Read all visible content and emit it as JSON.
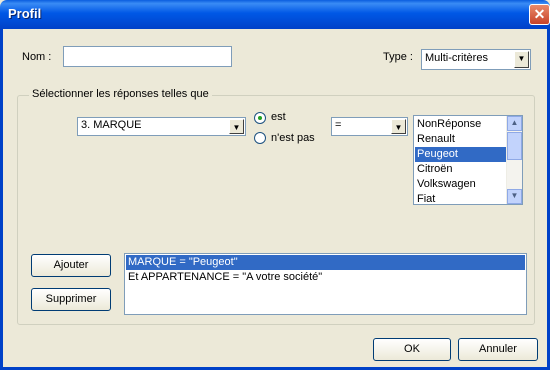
{
  "window": {
    "title": "Profil",
    "close_icon": "close-icon"
  },
  "form": {
    "nom_label": "Nom :",
    "nom_value": "",
    "type_label": "Type :",
    "type_value": "Multi-critères"
  },
  "group": {
    "title": "Sélectionner les réponses telles que",
    "question_value": "3. MARQUE",
    "radio_est": "est",
    "radio_nest_pas": "n'est pas",
    "radio_selected": "est",
    "operator_value": "=",
    "answers": [
      {
        "label": "NonRéponse",
        "selected": false
      },
      {
        "label": "Renault",
        "selected": false
      },
      {
        "label": "Peugeot",
        "selected": true
      },
      {
        "label": "Citroën",
        "selected": false
      },
      {
        "label": "Volkswagen",
        "selected": false
      },
      {
        "label": "Fiat",
        "selected": false
      }
    ],
    "ajouter_label": "Ajouter",
    "supprimer_label": "Supprimer",
    "criteria": [
      {
        "text": "MARQUE = \"Peugeot\"",
        "selected": true
      },
      {
        "text": "Et APPARTENANCE = \"A votre société\"",
        "selected": false
      }
    ]
  },
  "buttons": {
    "ok_label": "OK",
    "annuler_label": "Annuler"
  },
  "colors": {
    "titlebar": "#0058e6",
    "selection": "#316ac5",
    "dialog_bg": "#ece9d8"
  }
}
